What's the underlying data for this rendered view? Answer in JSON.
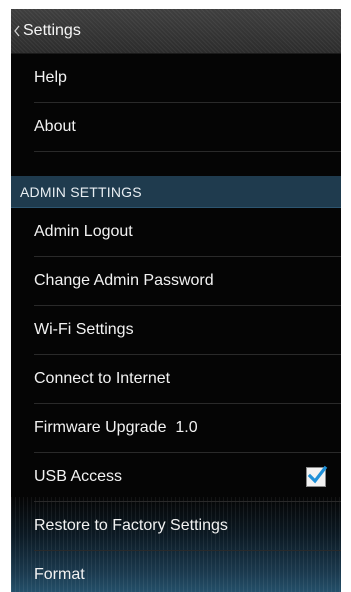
{
  "header": {
    "title": "Settings"
  },
  "top_items": [
    {
      "label": "Help"
    },
    {
      "label": "About"
    }
  ],
  "admin_section": {
    "header": "ADMIN SETTINGS",
    "items": [
      {
        "label": "Admin Logout"
      },
      {
        "label": "Change Admin Password"
      },
      {
        "label": "Wi-Fi Settings"
      },
      {
        "label": "Connect to Internet"
      },
      {
        "label": "Firmware Upgrade  1.0"
      },
      {
        "label": "USB Access",
        "checked": true
      },
      {
        "label": "Restore to Factory Settings"
      },
      {
        "label": "Format"
      }
    ]
  },
  "colors": {
    "background": "#050505",
    "section_header": "#1f3b4e",
    "checkmark": "#1e90d8"
  },
  "icons": {
    "back": "chevron-left-icon",
    "check": "checkmark-icon"
  }
}
